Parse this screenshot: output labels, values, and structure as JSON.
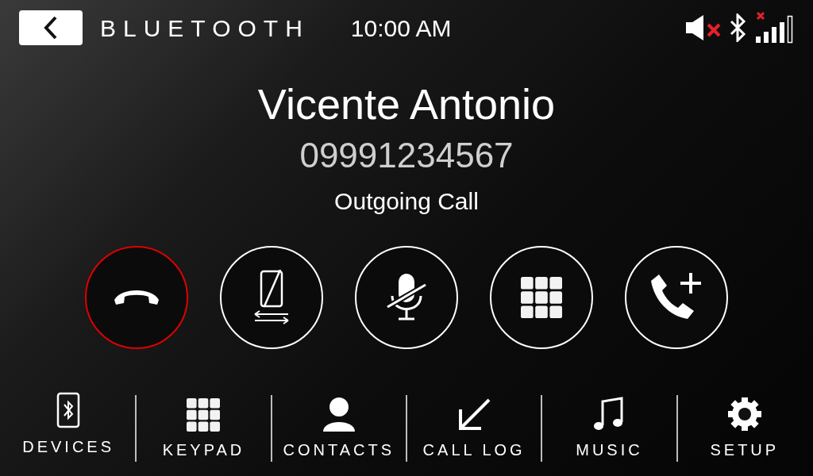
{
  "top_bar": {
    "title": "BLUETOOTH",
    "time": "10:00 AM"
  },
  "call": {
    "name": "Vicente Antonio",
    "number": "09991234567",
    "status": "Outgoing Call"
  },
  "actions": [
    {
      "kind": "end"
    },
    {
      "kind": "transfer"
    },
    {
      "kind": "mute"
    },
    {
      "kind": "keypad"
    },
    {
      "kind": "add"
    }
  ],
  "nav": [
    {
      "kind": "devices",
      "label": "DEVICES"
    },
    {
      "kind": "keypad",
      "label": "KEYPAD"
    },
    {
      "kind": "contacts",
      "label": "CONTACTS"
    },
    {
      "kind": "calllog",
      "label": "CALL LOG"
    },
    {
      "kind": "music",
      "label": "MUSIC"
    },
    {
      "kind": "setup",
      "label": "SETUP"
    }
  ]
}
